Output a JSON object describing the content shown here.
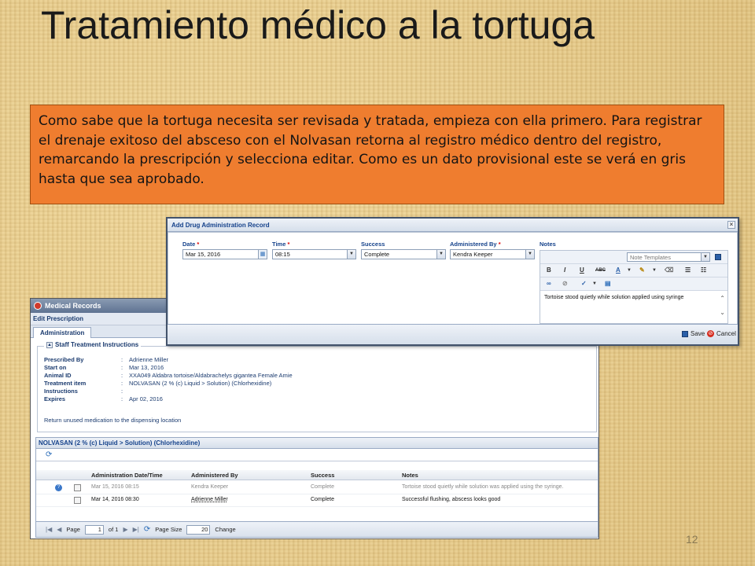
{
  "slide": {
    "title": "Tratamiento médico a la tortuga",
    "note": "Como sabe que la tortuga necesita ser revisada y tratada, empieza con ella primero. Para registrar el drenaje exitoso del absceso con el Nolvasan retorna al registro médico dentro del registro, remarcando la prescripción  y selecciona editar. Como es un dato provisional este se verá en gris hasta que sea aprobado.",
    "page_number": "12",
    "note_color": "#ef7d2f"
  },
  "med_window": {
    "title": "Medical Records",
    "subtitle": "Edit Prescription",
    "tab": "Administration",
    "section_title": "Staff Treatment Instructions",
    "details": [
      {
        "label": "Prescribed By",
        "value": "Adrienne Miller"
      },
      {
        "label": "Start on",
        "value": "Mar 13, 2016"
      },
      {
        "label": "Animal ID",
        "value": "XXA049 Aldabra tortoise/Aldabrachelys gigantea Female Amie"
      },
      {
        "label": "Treatment item",
        "value": "NOLVASAN (2 % (c) Liquid > Solution) (Chlorhexidine)"
      },
      {
        "label": "Instructions",
        "value": ""
      },
      {
        "label": "Expires",
        "value": "Apr 02, 2016"
      }
    ],
    "return_note": "Return unused medication to the dispensing location",
    "grid": {
      "title": "NOLVASAN (2 % (c) Liquid > Solution) (Chlorhexidine)",
      "columns": [
        "Administration Date/Time",
        "Administered By",
        "Success",
        "Notes"
      ],
      "rows": [
        {
          "date": "Mar 15, 2016 08:15",
          "by": "Kendra Keeper",
          "success": "Complete",
          "notes": "Tortoise stood quietly while solution was applied using the syringe."
        },
        {
          "date": "Mar 14, 2016 08:30",
          "by": "Adrienne Miller",
          "success": "Complete",
          "notes": "Successful flushing, abscess looks good"
        }
      ],
      "pager": {
        "page_label": "Page",
        "page_value": "1",
        "of_label": "of 1",
        "page_size_label": "Page Size",
        "page_size_value": "20",
        "change_label": "Change"
      }
    }
  },
  "dialog": {
    "title": "Add Drug Administration Record",
    "fields": {
      "date_label": "Date",
      "date_value": "Mar 15, 2016",
      "time_label": "Time",
      "time_value": "08:15",
      "success_label": "Success",
      "success_value": "Complete",
      "administered_label": "Administered By",
      "administered_value": "Kendra Keeper",
      "notes_label": "Notes",
      "note_templates_placeholder": "Note Templates",
      "notes_text": "Tortoise stood quietly while solution applied using syringe"
    },
    "required_mark": "*",
    "toolbar": {
      "bold": "B",
      "italic": "I",
      "underline": "U",
      "strike": "ABC",
      "font_color": "A"
    },
    "buttons": {
      "save": "Save",
      "cancel": "Cancel"
    }
  }
}
